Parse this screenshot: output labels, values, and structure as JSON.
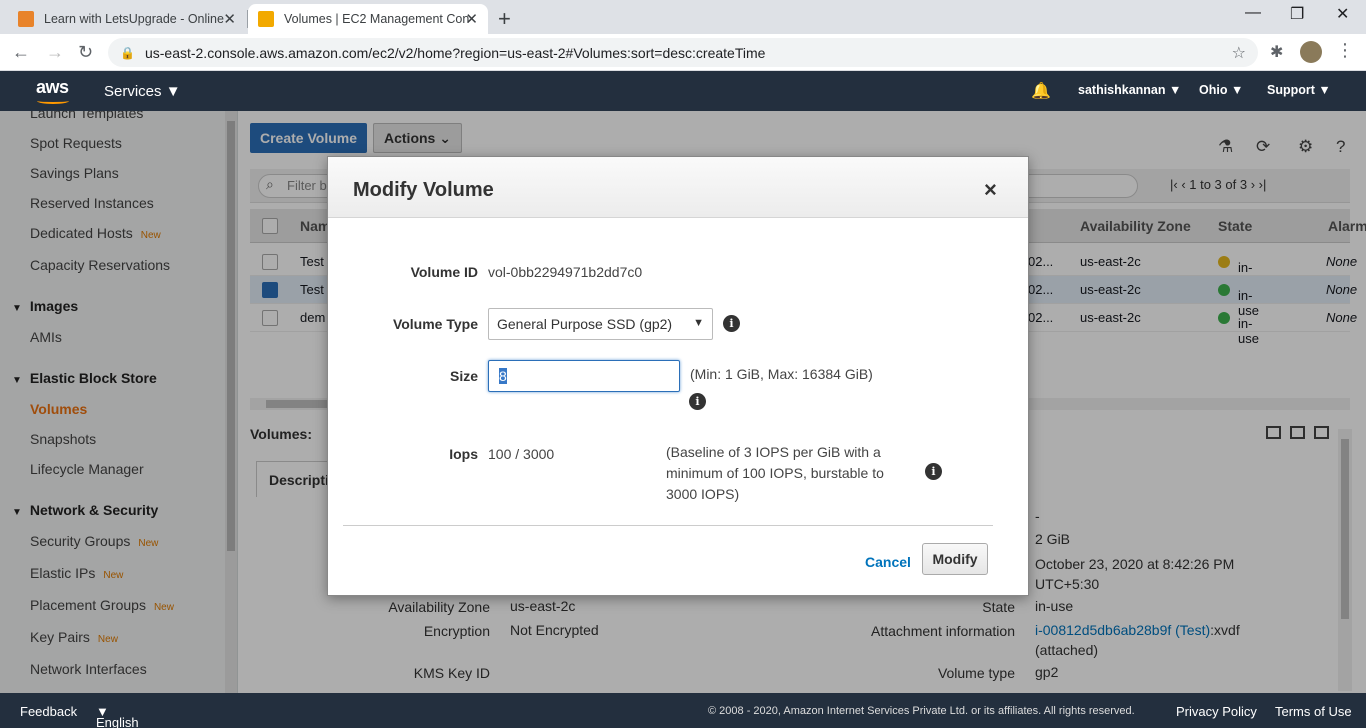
{
  "browser": {
    "tabs": [
      {
        "title": "Learn with LetsUpgrade - Online"
      },
      {
        "title": "Volumes | EC2 Management Con"
      }
    ],
    "url": "us-east-2.console.aws.amazon.com/ec2/v2/home?region=us-east-2#Volumes:sort=desc:createTime"
  },
  "awsnav": {
    "logo": "aws",
    "services": "Services",
    "user": "sathishkannan",
    "region": "Ohio",
    "support": "Support"
  },
  "sidebar": {
    "items": [
      {
        "label": "Launch Templates"
      },
      {
        "label": "Spot Requests"
      },
      {
        "label": "Savings Plans"
      },
      {
        "label": "Reserved Instances"
      },
      {
        "label": "Dedicated Hosts",
        "badge": "New"
      },
      {
        "label": "Capacity Reservations"
      }
    ],
    "images_head": "Images",
    "amis": "AMIs",
    "ebs_head": "Elastic Block Store",
    "volumes": "Volumes",
    "snapshots": "Snapshots",
    "lifecycle": "Lifecycle Manager",
    "net_head": "Network & Security",
    "security_groups": "Security Groups",
    "elastic_ips": "Elastic IPs",
    "placement_groups": "Placement Groups",
    "key_pairs": "Key Pairs",
    "network_interfaces": "Network Interfaces",
    "new_badge": "New"
  },
  "main": {
    "create_volume": "Create Volume",
    "actions": "Actions",
    "filter_placeholder": "Filter b",
    "pager": "1 to 3 of 3",
    "columns": {
      "name": "Nam",
      "az": "Availability Zone",
      "state": "State",
      "alarm": "Alarm"
    },
    "rows": [
      {
        "name": "Test",
        "trunc": "02...",
        "az": "us-east-2c",
        "state": "in-use - ...",
        "alarm": "None",
        "dot": "#e6b91e",
        "selected": false
      },
      {
        "name": "Test",
        "trunc": "02...",
        "az": "us-east-2c",
        "state": "in-use",
        "alarm": "None",
        "dot": "#3fb34f",
        "selected": true
      },
      {
        "name": "dem",
        "trunc": "02...",
        "az": "us-east-2c",
        "state": "in-use",
        "alarm": "None",
        "dot": "#3fb34f",
        "selected": false
      }
    ],
    "volumes_label": "Volumes:",
    "description_tab": "Descripti",
    "details": {
      "dash": "-",
      "size": "2 GiB",
      "created": "October 23, 2020 at 8:42:26 PM",
      "created_tz": "UTC+5:30",
      "az_label": "Availability Zone",
      "az": "us-east-2c",
      "state_label": "State",
      "state": "in-use",
      "encryption_label": "Encryption",
      "encryption": "Not Encrypted",
      "attach_label": "Attachment information",
      "attach_link": "i-00812d5db6ab28b9f (Test)",
      "attach_suffix": ":xvdf",
      "attached": "(attached)",
      "kms_label": "KMS Key ID",
      "vtype_label": "Volume type",
      "vtype": "gp2"
    }
  },
  "modal": {
    "title": "Modify Volume",
    "close": "×",
    "volume_id_label": "Volume ID",
    "volume_id": "vol-0bb2294971b2dd7c0",
    "volume_type_label": "Volume Type",
    "volume_type": "General Purpose SSD (gp2)",
    "size_label": "Size",
    "size_value": "8",
    "size_hint": "(Min: 1 GiB, Max: 16384 GiB)",
    "iops_label": "Iops",
    "iops_value": "100 / 3000",
    "iops_note": "(Baseline of 3 IOPS per GiB with a minimum of 100 IOPS, burstable to 3000 IOPS)",
    "cancel": "Cancel",
    "modify": "Modify"
  },
  "footer": {
    "feedback": "Feedback",
    "language": "English (US)",
    "copyright": "© 2008 - 2020, Amazon Internet Services Private Ltd. or its affiliates. All rights reserved.",
    "privacy": "Privacy Policy",
    "terms": "Terms of Use"
  },
  "colors": {
    "aws_nav": "#232f3e",
    "accent": "#ec7211",
    "primary": "#2b6fb8",
    "link": "#0073bb"
  }
}
